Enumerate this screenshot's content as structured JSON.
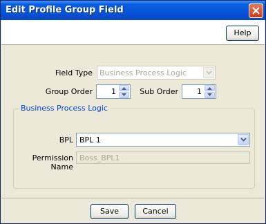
{
  "window": {
    "title": "Edit Profile Group Field"
  },
  "toolbar": {
    "help_label": "Help"
  },
  "form": {
    "field_type": {
      "label": "Field Type",
      "value": "Business Process Logic"
    },
    "group_order": {
      "label": "Group Order",
      "value": "1"
    },
    "sub_order": {
      "label": "Sub Order",
      "value": "1"
    },
    "bpl_group": {
      "title": "Business Process Logic",
      "bpl": {
        "label": "BPL",
        "value": "BPL 1"
      },
      "permission_name": {
        "label": "Permission Name",
        "value": "Boss_BPL1"
      }
    }
  },
  "footer": {
    "save_label": "Save",
    "cancel_label": "Cancel"
  },
  "icons": {
    "close": "close-icon",
    "dropdown": "chevron-down-icon",
    "spin_up": "arrow-up-icon",
    "spin_down": "arrow-down-icon"
  },
  "colors": {
    "titlebar": "#0553d8",
    "window_bg": "#ece9d8",
    "group_title": "#0046d5",
    "close_button": "#c7381b"
  }
}
